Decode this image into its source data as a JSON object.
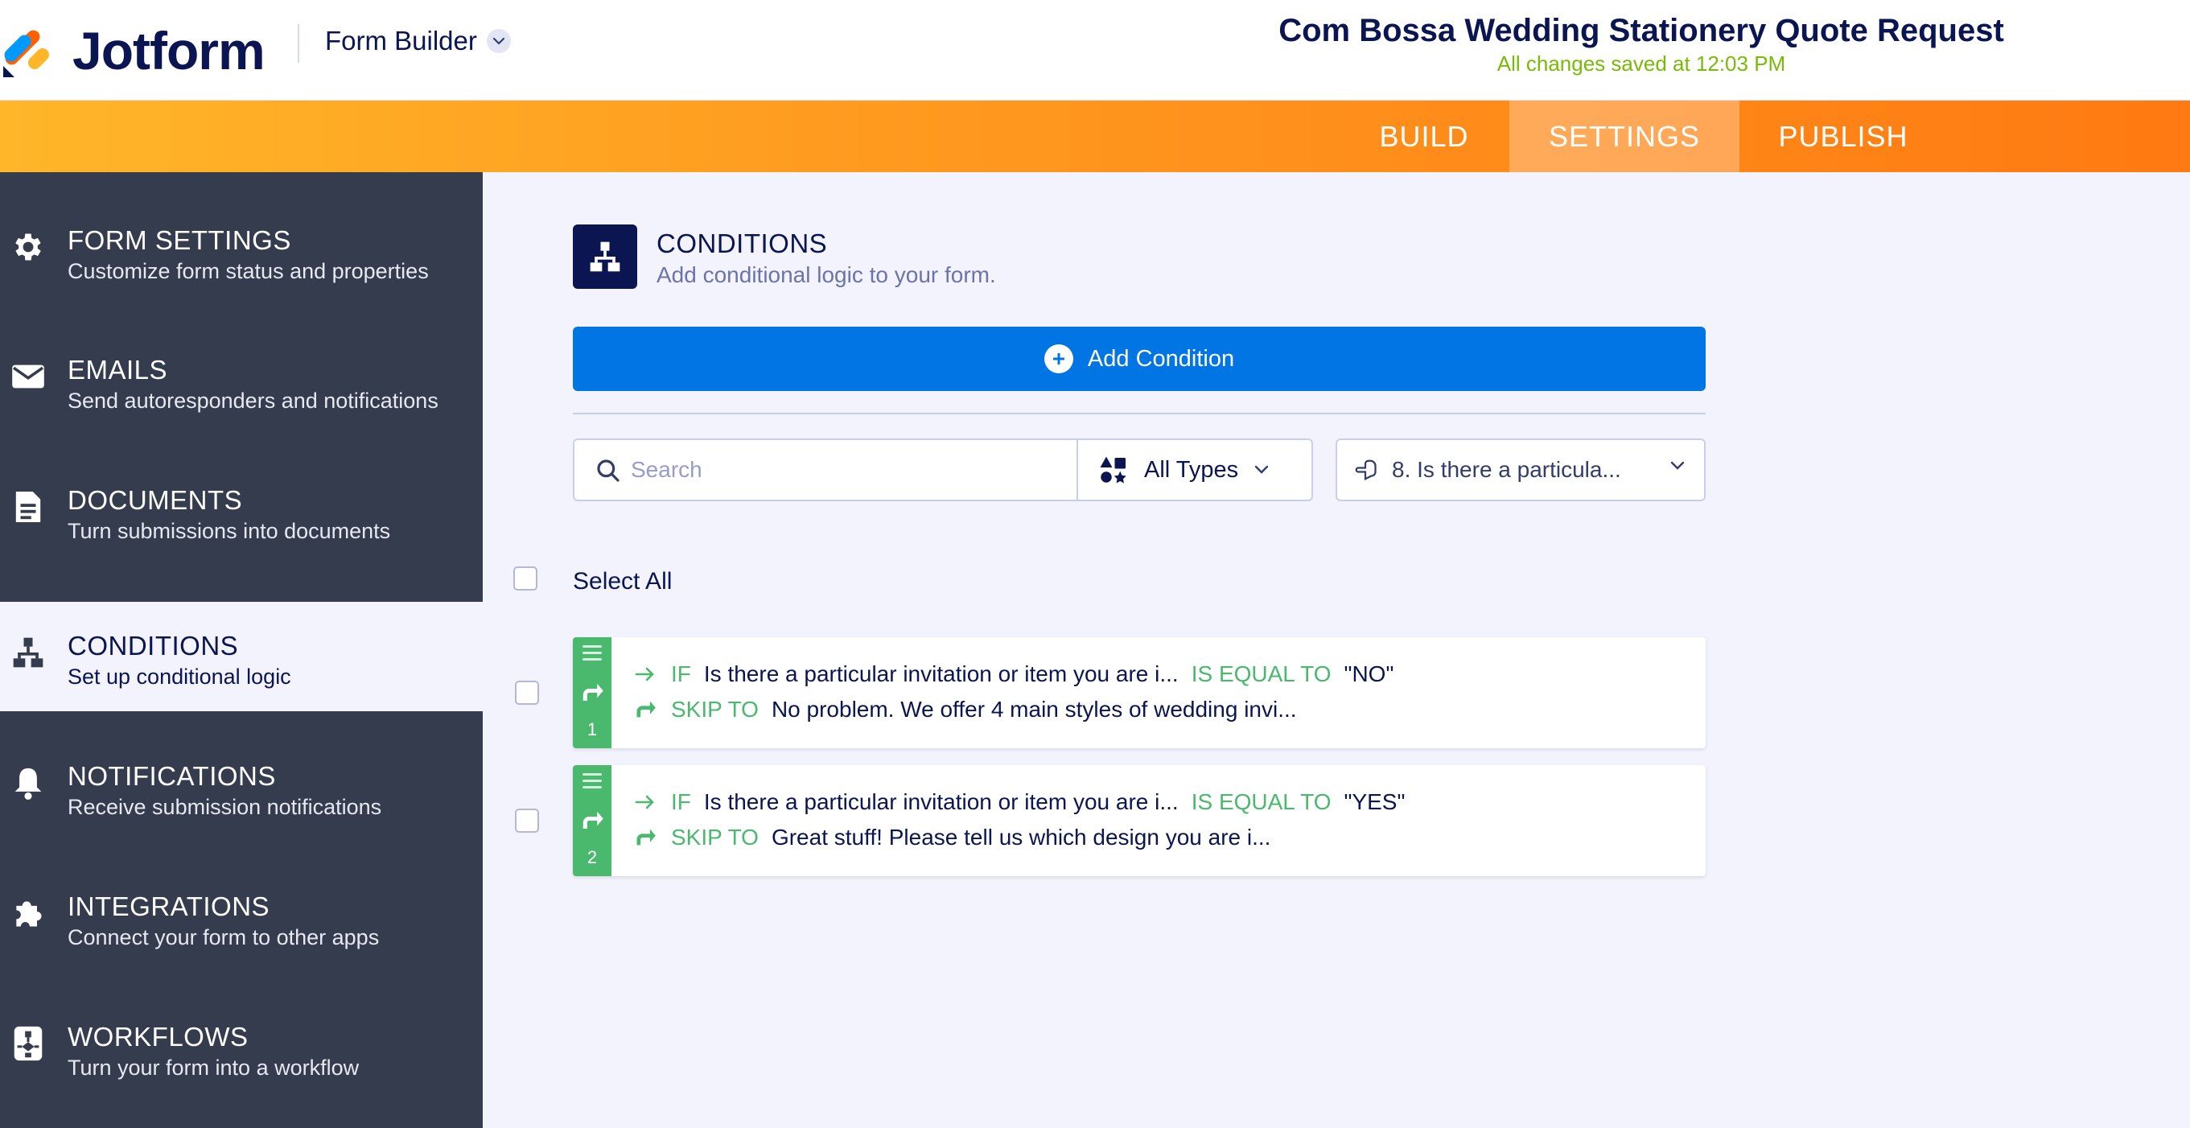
{
  "brand": {
    "logo_text": "Jotform",
    "accent": "#ff6100",
    "navy": "#0a1551",
    "blue": "#0075e3",
    "green": "#4ab86d"
  },
  "header": {
    "builder_label": "Form Builder",
    "form_title": "Com Bossa Wedding Stationery Quote Request",
    "save_status": "All changes saved at 12:03 PM"
  },
  "nav": {
    "tabs": [
      {
        "label": "BUILD"
      },
      {
        "label": "SETTINGS",
        "active": true
      },
      {
        "label": "PUBLISH"
      }
    ]
  },
  "sidebar": {
    "items": [
      {
        "title": "FORM SETTINGS",
        "subtitle": "Customize form status and properties",
        "icon": "gear-icon"
      },
      {
        "title": "EMAILS",
        "subtitle": "Send autoresponders and notifications",
        "icon": "envelope-icon"
      },
      {
        "title": "DOCUMENTS",
        "subtitle": "Turn submissions into documents",
        "icon": "document-icon"
      },
      {
        "title": "CONDITIONS",
        "subtitle": "Set up conditional logic",
        "icon": "hierarchy-icon",
        "active": true
      },
      {
        "title": "NOTIFICATIONS",
        "subtitle": "Receive submission notifications",
        "icon": "bell-icon"
      },
      {
        "title": "INTEGRATIONS",
        "subtitle": "Connect your form to other apps",
        "icon": "puzzle-icon"
      },
      {
        "title": "WORKFLOWS",
        "subtitle": "Turn your form into a workflow",
        "icon": "workflow-icon"
      }
    ]
  },
  "main": {
    "title": "CONDITIONS",
    "subtitle": "Add conditional logic to your form.",
    "add_button_label": "Add Condition",
    "search_placeholder": "Search",
    "type_filter": "All Types",
    "field_filter": "8. Is there a particula...",
    "select_all_label": "Select All",
    "conditions": [
      {
        "number": "1",
        "if_label": "IF",
        "field": "Is there a particular invitation or item you are i...",
        "operator": "IS EQUAL TO",
        "value": "\"NO\"",
        "action_label": "SKIP TO",
        "target": "No problem. We offer 4 main styles of wedding invi..."
      },
      {
        "number": "2",
        "if_label": "IF",
        "field": "Is there a particular invitation or item you are i...",
        "operator": "IS EQUAL TO",
        "value": "\"YES\"",
        "action_label": "SKIP TO",
        "target": "Great stuff! Please tell us which design you are i..."
      }
    ]
  }
}
